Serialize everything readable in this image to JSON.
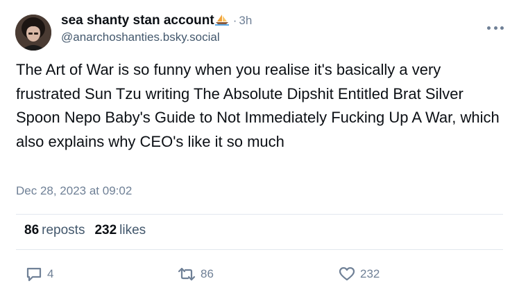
{
  "author": {
    "display_name": "sea shanty stan account",
    "handle": "@anarchoshanties.bsky.social",
    "time_ago": "3h",
    "separator": "·",
    "badge_icon": "sailboat-icon"
  },
  "post": {
    "text": "The Art of War is so funny when you realise it's basically a very frustrated Sun Tzu writing The Absolute Dipshit Entitled Brat Silver Spoon Nepo Baby's Guide to Not Immediately Fucking Up A War, which also explains why CEO's like it so much",
    "timestamp": "Dec 28, 2023 at 09:02"
  },
  "stats": {
    "reposts_count": "86",
    "reposts_label": "reposts",
    "likes_count": "232",
    "likes_label": "likes"
  },
  "actions": {
    "reply_count": "4",
    "repost_count": "86",
    "like_count": "232"
  },
  "colors": {
    "text": "#0b0f14",
    "muted": "#6f8096",
    "handle": "#42576c",
    "divider": "#e2e7ee"
  }
}
